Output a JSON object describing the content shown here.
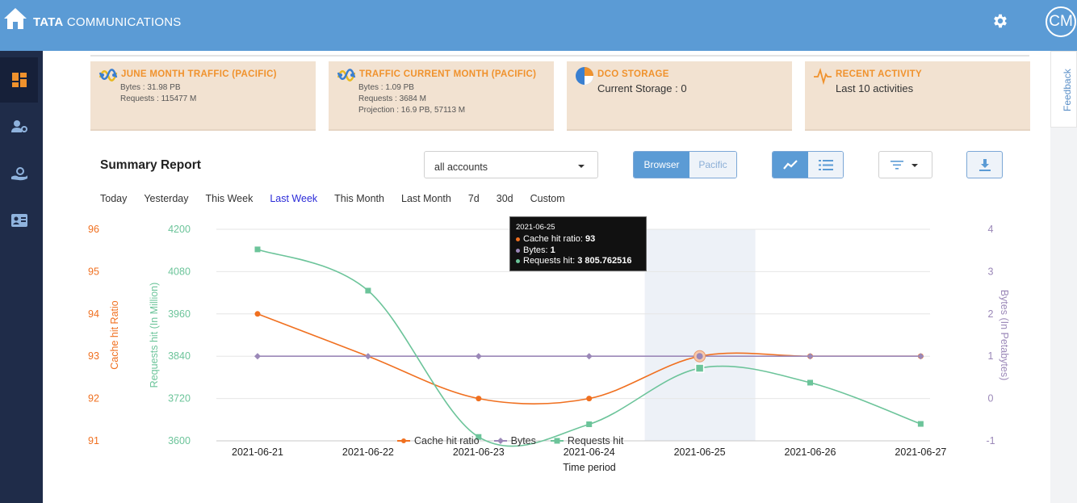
{
  "app": {
    "brand_bold": "TATA",
    "brand_rest": "COMMUNICATIONS",
    "avatar_initials": "CM",
    "colors": {
      "topbar": "#5b9bd5",
      "sidebar": "#1f2c49",
      "card_bg": "#f2e2d1",
      "card_title": "#f0922d"
    }
  },
  "sidebar": {
    "items": [
      {
        "icon": "dashboard-icon",
        "active": true
      },
      {
        "icon": "user-settings-icon",
        "active": false
      },
      {
        "icon": "hand-gear-icon",
        "active": false
      },
      {
        "icon": "contact-card-icon",
        "active": false
      }
    ]
  },
  "feedback": {
    "label": "Feedback"
  },
  "cards": [
    {
      "icon": "traffic-icon",
      "title": "JUNE MONTH TRAFFIC (PACIFIC)",
      "lines": [
        "Bytes : 31.98 PB",
        "Requests : 115477 M"
      ]
    },
    {
      "icon": "traffic-icon",
      "title": "TRAFFIC CURRENT MONTH (PACIFIC)",
      "lines": [
        "Bytes : 1.09 PB",
        "Requests : 3684 M",
        "Projection : 16.9 PB, 57113 M"
      ]
    },
    {
      "icon": "pie-chart-icon",
      "title": "DCO STORAGE",
      "big": "Current Storage : 0"
    },
    {
      "icon": "activity-icon",
      "title": "RECENT ACTIVITY",
      "big": "Last 10 activities"
    }
  ],
  "report": {
    "title": "Summary Report",
    "account_select": {
      "value": "all accounts"
    },
    "source_toggle": {
      "options": [
        "Browser",
        "Pacific"
      ],
      "selected": "Browser"
    },
    "view_toggle": {
      "options": [
        "line-chart-icon",
        "list-icon"
      ],
      "selected": "line-chart-icon"
    },
    "periods": [
      "Today",
      "Yesterday",
      "This Week",
      "Last Week",
      "This Month",
      "Last Month",
      "7d",
      "30d",
      "Custom"
    ],
    "active_period": "Last Week"
  },
  "tooltip": {
    "date": "2021-06-25",
    "rows": [
      {
        "label": "Cache hit ratio:",
        "value": "93",
        "color": "#f07020"
      },
      {
        "label": "Bytes:",
        "value": "1",
        "color": "#9b88b8"
      },
      {
        "label": "Requests hit:",
        "value": "3 805.762516",
        "color": "#6cc49a"
      }
    ]
  },
  "chart_data": {
    "type": "line",
    "categories": [
      "2021-06-21",
      "2021-06-22",
      "2021-06-23",
      "2021-06-24",
      "2021-06-25",
      "2021-06-26",
      "2021-06-27"
    ],
    "xlabel": "Time period",
    "highlight_category": "2021-06-25",
    "axes": {
      "cache": {
        "label": "Cache hit Ratio",
        "ticks": [
          96,
          95,
          94,
          93,
          92,
          91
        ],
        "range": [
          91,
          96
        ],
        "color": "#f07020"
      },
      "requests": {
        "label": "Requests hit (In Million)",
        "ticks": [
          4200,
          4080,
          3960,
          3840,
          3720,
          3600
        ],
        "range": [
          3600,
          4200
        ],
        "color": "#6cc49a"
      },
      "bytes": {
        "label": "Bytes (In Petabytes)",
        "ticks": [
          4,
          3,
          2,
          1,
          0,
          -1
        ],
        "range": [
          -1,
          4
        ],
        "color": "#9b88b8"
      }
    },
    "series": [
      {
        "name": "Cache hit ratio",
        "axis": "cache",
        "color": "#f07020",
        "marker": "circle",
        "values": [
          94,
          null,
          92,
          92,
          93,
          93,
          93
        ]
      },
      {
        "name": "Bytes",
        "axis": "bytes",
        "color": "#9b88b8",
        "marker": "diamond",
        "values": [
          1,
          1,
          1,
          1,
          1,
          1,
          1
        ]
      },
      {
        "name": "Requests hit",
        "axis": "requests",
        "color": "#6cc49a",
        "marker": "square",
        "values": [
          4143,
          4026,
          3611,
          3647,
          3806,
          3765,
          3648
        ]
      }
    ],
    "curve_through": {
      "cache_2021-06-22": 93
    },
    "legend_position": "bottom"
  }
}
